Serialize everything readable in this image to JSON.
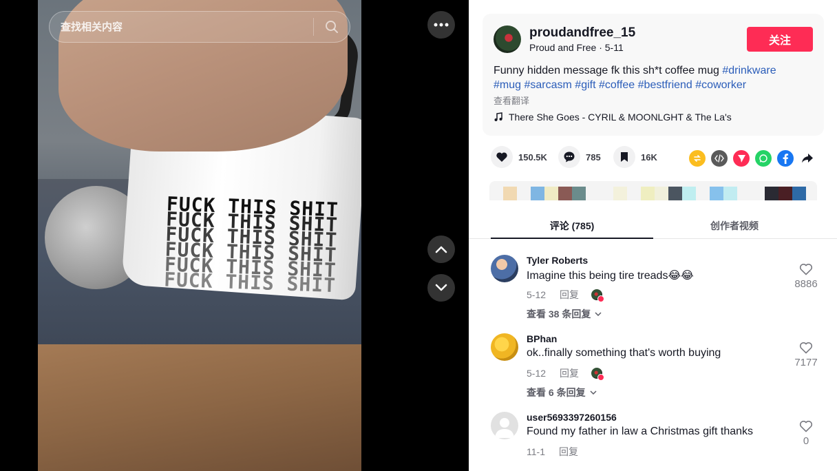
{
  "search": {
    "placeholder": "查找相关内容"
  },
  "video": {
    "mug_text_lines": [
      "FUCK THIS SHIT",
      "FUCK THIS SHIT",
      "FUCK THIS SHIT",
      "FUCK THIS SHIT",
      "FUCK THIS SHIT",
      "FUCK THIS SHIT"
    ]
  },
  "author": {
    "username": "proudandfree_15",
    "display_name": "Proud and Free",
    "date": "5-11",
    "follow_label": "关注"
  },
  "description": {
    "text": "Funny hidden message fk this sh*t coffee mug",
    "hashtags": [
      "#drinkware",
      "#mug",
      "#sarcasm",
      "#gift",
      "#coffee",
      "#bestfriend",
      "#coworker"
    ],
    "translate_label": "查看翻译"
  },
  "music": {
    "title": "There She Goes - CYRIL & MOONLGHT & The La's"
  },
  "stats": {
    "likes": "150.5K",
    "comments": "785",
    "saves": "16K"
  },
  "share_icons": [
    "repost-icon",
    "embed-icon",
    "send-icon",
    "whatsapp-icon",
    "facebook-icon",
    "share-arrow-icon"
  ],
  "colors": {
    "accent": "#fe2c55",
    "hashtag": "#2b5db9",
    "repost": "#fbbd1f",
    "embed": "#5a5a5a",
    "send": "#fe2c55",
    "whatsapp": "#25d366",
    "facebook": "#1877f2",
    "swatches": [
      "#f4f4f4",
      "#f1d9b2",
      "#f4f4f4",
      "#7fb6e3",
      "#f0ebc4",
      "#8a5a55",
      "#6b8c8c",
      "#f4f4f4",
      "#f4f4f4",
      "#f3f1dc",
      "#f4f4f4",
      "#efeec0",
      "#f1f0dc",
      "#4b5560",
      "#bfeef0",
      "#f4f4f4",
      "#86c1ec",
      "#c1ecf1",
      "#f4f4f4",
      "#f4f4f4",
      "#2a2a33",
      "#4a1f24",
      "#2e6aa6"
    ]
  },
  "tabs": [
    {
      "label": "评论 (785)",
      "active": true
    },
    {
      "label": "创作者视频",
      "active": false
    }
  ],
  "comments": [
    {
      "name": "Tyler Roberts",
      "text": "Imagine this being tire treads😂😂",
      "date": "5-12",
      "reply_label": "回复",
      "more": "查看 38 条回复",
      "likes": "8886",
      "author_liked": true,
      "avatar_color": "#8aa3c9"
    },
    {
      "name": "BPhan",
      "text": "ok..finally something that's worth buying",
      "date": "5-12",
      "reply_label": "回复",
      "more": "查看 6 条回复",
      "likes": "7177",
      "author_liked": true,
      "avatar_color": "#f0b623"
    },
    {
      "name": "user5693397260156",
      "text": "Found my father in law a Christmas gift thanks",
      "date": "11-1",
      "reply_label": "回复",
      "more": "",
      "likes": "0",
      "author_liked": false,
      "avatar_color": "#d9d9d9"
    }
  ]
}
